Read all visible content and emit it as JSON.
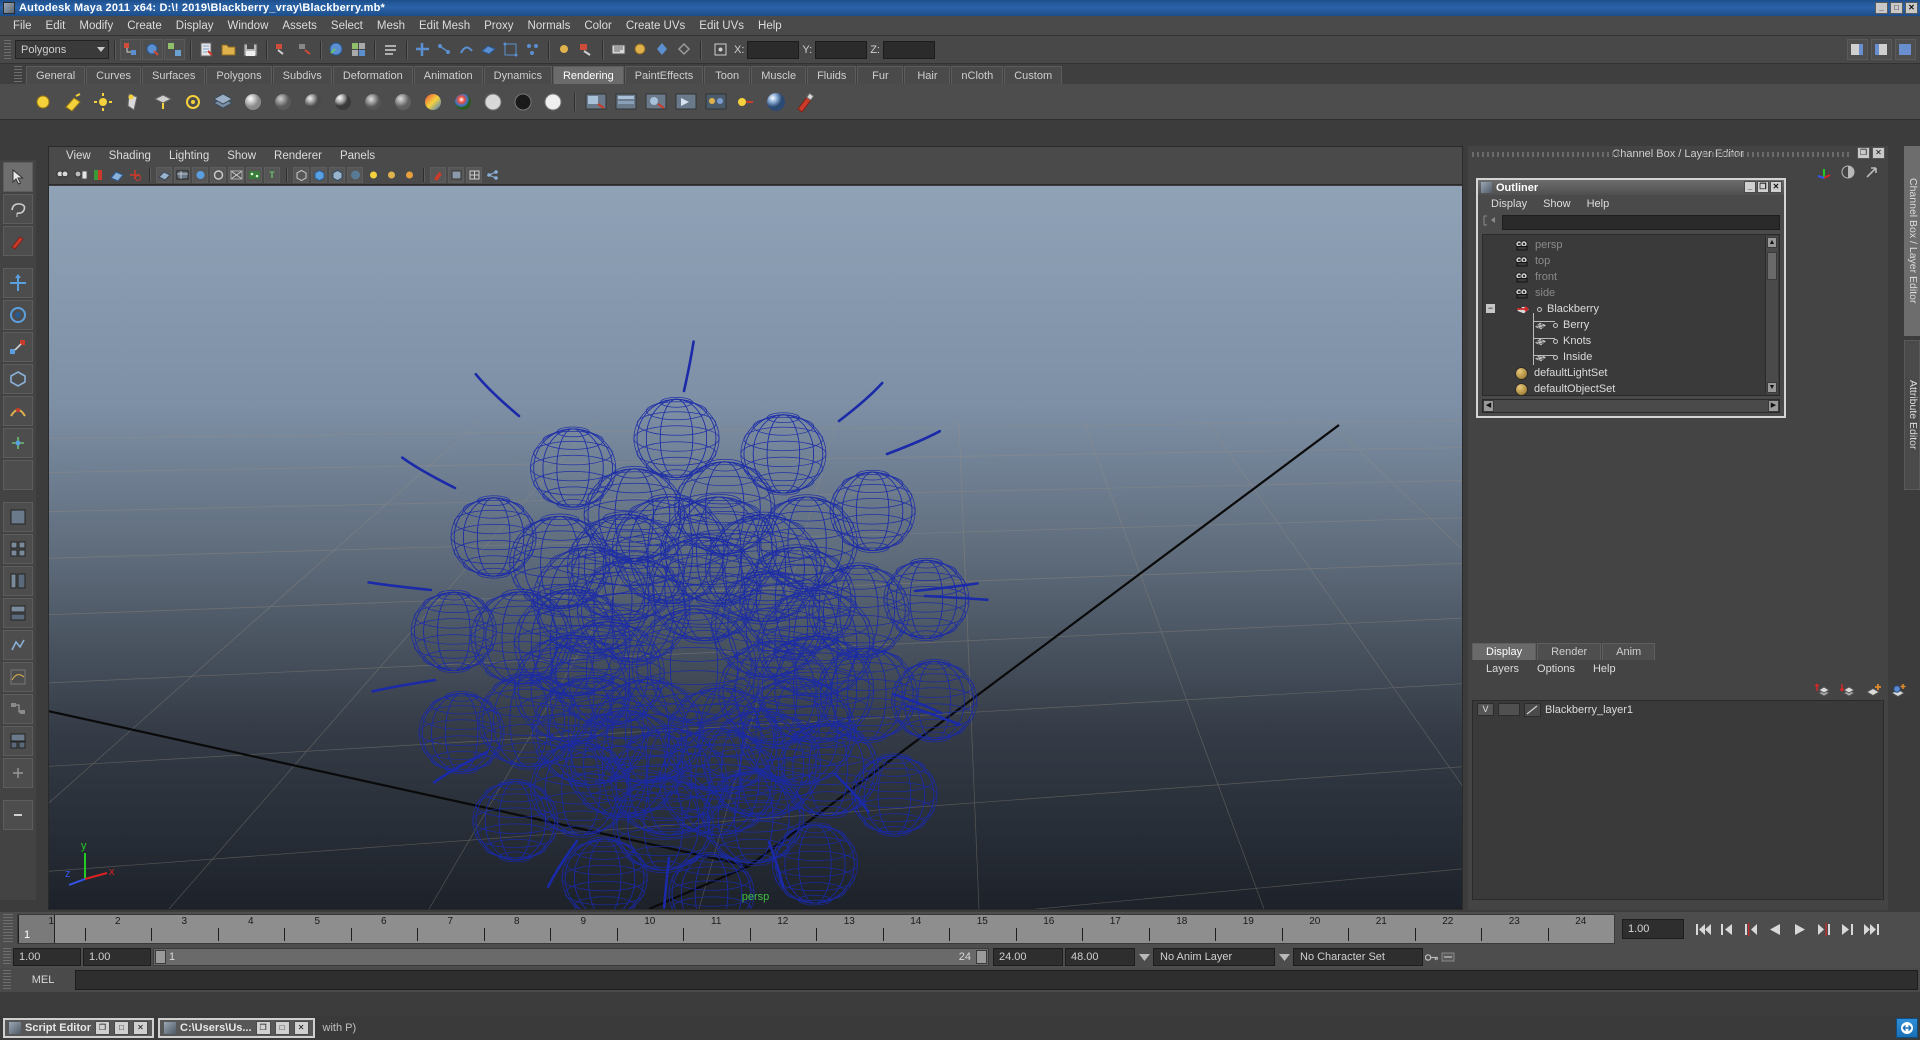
{
  "window": {
    "title": "Autodesk Maya 2011 x64: D:\\! 2019\\Blackberry_vray\\Blackberry.mb*",
    "minimize": "_",
    "maximize": "□",
    "close": "✕"
  },
  "menubar": {
    "items": [
      "File",
      "Edit",
      "Modify",
      "Create",
      "Display",
      "Window",
      "Assets",
      "Select",
      "Mesh",
      "Edit Mesh",
      "Proxy",
      "Normals",
      "Color",
      "Create UVs",
      "Edit UVs",
      "Help"
    ]
  },
  "statusline": {
    "mode": "Polygons",
    "x_label": "X:",
    "y_label": "Y:",
    "z_label": "Z:",
    "x_value": "",
    "y_value": "",
    "z_value": ""
  },
  "shelf": {
    "tabs": [
      "General",
      "Curves",
      "Surfaces",
      "Polygons",
      "Subdivs",
      "Deformation",
      "Animation",
      "Dynamics",
      "Rendering",
      "PaintEffects",
      "Toon",
      "Muscle",
      "Fluids",
      "Fur",
      "Hair",
      "nCloth",
      "Custom"
    ],
    "active_tab": "Rendering"
  },
  "viewport": {
    "menus": [
      "View",
      "Shading",
      "Lighting",
      "Show",
      "Renderer",
      "Panels"
    ],
    "camera_label": "persp",
    "axis": {
      "x": "x",
      "y": "y",
      "z": "z"
    },
    "colors": {
      "sky_top": "#8a9cb0",
      "ground_bottom": "#222831",
      "wireframe": "#2233aa",
      "grid": "#9a8f80"
    }
  },
  "channelbox": {
    "header_title": "Channel Box / Layer Editor",
    "restore": "❐",
    "close": "✕"
  },
  "outliner": {
    "title": "Outliner",
    "minimize": "_",
    "maximize": "❐",
    "close": "✕",
    "menus": [
      "Display",
      "Show",
      "Help"
    ],
    "search_value": "",
    "items": [
      {
        "label": "persp",
        "icon": "camera-icon",
        "dim": true,
        "indent": 22,
        "expander": ""
      },
      {
        "label": "top",
        "icon": "camera-icon",
        "dim": true,
        "indent": 22,
        "expander": ""
      },
      {
        "label": "front",
        "icon": "camera-icon",
        "dim": true,
        "indent": 22,
        "expander": ""
      },
      {
        "label": "side",
        "icon": "camera-icon",
        "dim": true,
        "indent": 22,
        "expander": ""
      },
      {
        "label": "Blackberry",
        "icon": "transform-icon",
        "dim": false,
        "indent": 22,
        "expander": "−"
      },
      {
        "label": "Berry",
        "icon": "mesh-icon",
        "dim": false,
        "indent": 40,
        "expander": ""
      },
      {
        "label": "Knots",
        "icon": "mesh-icon",
        "dim": false,
        "indent": 40,
        "expander": ""
      },
      {
        "label": "Inside",
        "icon": "mesh-icon",
        "dim": false,
        "indent": 40,
        "expander": ""
      },
      {
        "label": "defaultLightSet",
        "icon": "set-icon",
        "dim": false,
        "indent": 22,
        "expander": ""
      },
      {
        "label": "defaultObjectSet",
        "icon": "set-icon",
        "dim": false,
        "indent": 22,
        "expander": ""
      }
    ]
  },
  "layereditor": {
    "tabs": [
      "Display",
      "Render",
      "Anim"
    ],
    "active_tab": "Display",
    "menus": [
      "Layers",
      "Options",
      "Help"
    ],
    "layers": [
      {
        "visibility": "V",
        "shading": "",
        "name": "Blackberry_layer1"
      }
    ]
  },
  "sidetabs": {
    "items": [
      "Channel Box / Layer Editor",
      "Attribute Editor"
    ],
    "active": "Channel Box / Layer Editor"
  },
  "timeline": {
    "current_frame_label": "1",
    "ticks": [
      1,
      2,
      3,
      4,
      5,
      6,
      7,
      8,
      9,
      10,
      11,
      12,
      13,
      14,
      15,
      16,
      17,
      18,
      19,
      20,
      21,
      22,
      23,
      24
    ],
    "current_time_field": "1.00",
    "playback_buttons": [
      "go-to-start",
      "step-back-key",
      "step-back-frame",
      "play-backwards",
      "play-forwards",
      "step-forward-frame",
      "step-forward-key",
      "go-to-end"
    ]
  },
  "rangeslider": {
    "anim_start": "1.00",
    "range_start": "1.00",
    "range_bar_start_label": "1",
    "range_bar_end_label": "24",
    "range_end": "24.00",
    "anim_end": "48.00",
    "anim_layer": "No Anim Layer",
    "character_set": "No Character Set"
  },
  "commandline": {
    "language": "MEL",
    "input_value": ""
  },
  "taskbar": {
    "items": [
      {
        "label": "Script Editor",
        "restore": "❐",
        "maximize": "□",
        "close": "✕"
      },
      {
        "label": "C:\\Users\\Us...",
        "restore": "❐",
        "maximize": "□",
        "close": "✕"
      }
    ],
    "message": "with P)"
  }
}
